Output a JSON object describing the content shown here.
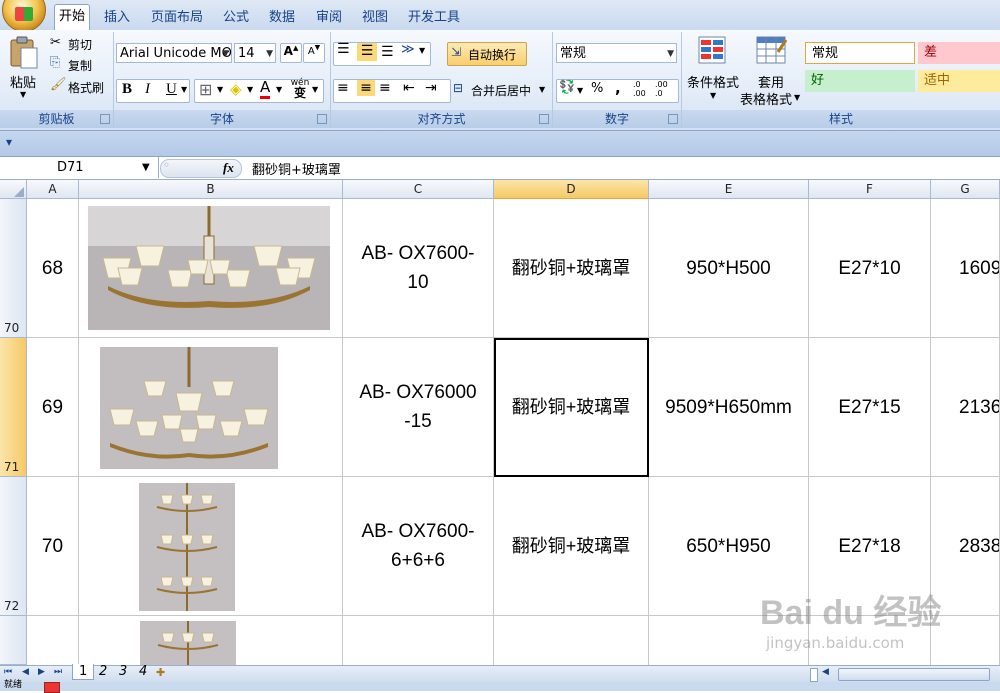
{
  "ribbon": {
    "tabs": [
      "开始",
      "插入",
      "页面布局",
      "公式",
      "数据",
      "审阅",
      "视图",
      "开发工具"
    ],
    "clipboard": {
      "paste": "粘贴",
      "cut": "剪切",
      "copy": "复制",
      "format_painter": "格式刷",
      "label": "剪贴板"
    },
    "font": {
      "name": "Arial Unicode MΘ",
      "size": "14",
      "label": "字体",
      "bold": "B",
      "italic": "I",
      "underline": "U",
      "phonetic": "wén"
    },
    "alignment": {
      "wrap": "自动换行",
      "merge": "合并后居中",
      "label": "对齐方式"
    },
    "number": {
      "format": "常规",
      "percent": "%",
      "comma": ",",
      "inc": ".0 .00",
      "dec": ".00 .0",
      "label": "数字"
    },
    "styles": {
      "conditional": "条件格式",
      "table_line1": "套用",
      "table_line2": "表格格式",
      "label": "样式",
      "cells": [
        {
          "text": "常规",
          "bg": "#ffffff",
          "fg": "#000000"
        },
        {
          "text": "差",
          "bg": "#ffc7ce",
          "fg": "#9c0006"
        },
        {
          "text": "好",
          "bg": "#c6efce",
          "fg": "#006100"
        },
        {
          "text": "适中",
          "bg": "#ffeb9c",
          "fg": "#9c6500"
        }
      ]
    }
  },
  "formula_bar": {
    "name_box": "D71",
    "fx": "fx",
    "content": "翻砂铜+玻璃罩"
  },
  "columns": [
    "A",
    "B",
    "C",
    "D",
    "E",
    "F",
    "G"
  ],
  "selected_column": "D",
  "rows": [
    {
      "row_num": "70",
      "a": "68",
      "c_line1": "AB- OX7600-",
      "c_line2": "10",
      "d": "翻砂铜+玻璃罩",
      "e": "950*H500",
      "f": "E27*10",
      "g": "1609"
    },
    {
      "row_num": "71",
      "a": "69",
      "c_line1": "AB- OX76000",
      "c_line2": "-15",
      "d": "翻砂铜+玻璃罩",
      "e": "9509*H650mm",
      "f": "E27*15",
      "g": "2136"
    },
    {
      "row_num": "72",
      "a": "70",
      "c_line1": "AB- OX7600-",
      "c_line2": "6+6+6",
      "d": "翻砂铜+玻璃罩",
      "e": "650*H950",
      "f": "E27*18",
      "g": "2838"
    }
  ],
  "sheet_tabs": [
    "1",
    "2",
    "3",
    "4"
  ],
  "status": "就绪",
  "watermark": {
    "line1": "Bai du 经验",
    "line2": "jingyan.baidu.com"
  }
}
